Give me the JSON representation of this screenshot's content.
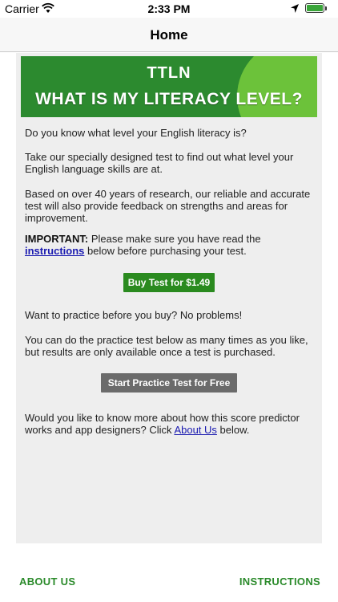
{
  "status_bar": {
    "carrier": "Carrier",
    "time": "2:33 PM"
  },
  "nav": {
    "title": "Home"
  },
  "banner": {
    "logo": "TTLN",
    "headline": "WHAT IS MY LITERACY LEVEL?"
  },
  "content": {
    "p1": "Do you know what level your English literacy is?",
    "p2": "Take our specially designed test to find out what level your English language skills are at.",
    "p3": "Based on over 40 years of research, our reliable and accurate test will also provide feedback on strengths and areas for improvement.",
    "important_label": "IMPORTANT:",
    "important_text": " Please make sure you have read the ",
    "instructions_link": "instructions",
    "important_tail": " below before purchasing your test.",
    "buy_button": "Buy Test for $1.49",
    "p5": "Want to practice before you buy? No problems!",
    "p6": "You can do the practice test below as many times as you like, but results are only available once a test is purchased.",
    "practice_button": "Start Practice Test for Free",
    "p7_prefix": "Would you like to know more about how this score predictor works and app designers? Click ",
    "about_link": "About Us",
    "p7_suffix": " below."
  },
  "footer": {
    "about": "ABOUT US",
    "instructions": "INSTRUCTIONS"
  },
  "colors": {
    "brand_green": "#2c8a2f",
    "accent_green": "#6cc23a",
    "link_blue": "#1a1ab0",
    "practice_gray": "#6b6b6b"
  }
}
